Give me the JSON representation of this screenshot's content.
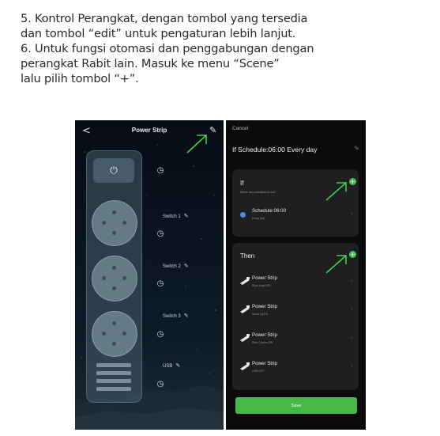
{
  "instructions": {
    "line1": "5. Kontrol Perangkat, dengan tombol yang tersedia",
    "line2": "dan tombol “edit” untuk pengaturan lebih lanjut.",
    "line3": "6. Untuk fungsi otomasi dan penggabungan dengan",
    "line4": "perangkat Rabit lain. Masuk ke menu “Scene”",
    "line5": "lalu pilih tombol “+”."
  },
  "left_screen": {
    "back_glyph": "<",
    "title": "Power Strip",
    "edit_icon": "pencil-icon",
    "power_icon": "power-icon",
    "timer_icon": "clock-icon",
    "switches": [
      {
        "label": "Switch 1"
      },
      {
        "label": "Switch 2"
      },
      {
        "label": "Switch 3"
      },
      {
        "label": "USB"
      }
    ]
  },
  "right_screen": {
    "cancel": "Cancel",
    "heading": "If Schedule:06:00 Every day",
    "if_card": {
      "title": "If",
      "subtitle": "When any condition is met",
      "condition_name": "Schedule:06:00",
      "condition_detail": "Every day"
    },
    "then_card": {
      "title": "Then",
      "actions": [
        {
          "name": "Power Strip",
          "detail": "Bijou Angt:OFF"
        },
        {
          "name": "Power Strip",
          "detail": "Mood Lg:ON"
        },
        {
          "name": "Power Strip",
          "detail": "Rice Cooker:ON"
        },
        {
          "name": "Power Strip",
          "detail": "USB:OFF"
        }
      ]
    },
    "save": "Save"
  },
  "colors": {
    "accent_green": "#46c14f",
    "save_green": "#49b84a",
    "arrow_green": "#3ecf53"
  }
}
